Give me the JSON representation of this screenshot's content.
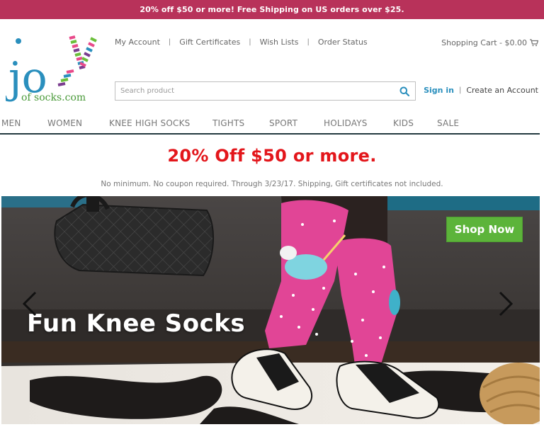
{
  "promo": {
    "text": "20% off $50 or more! Free Shipping on US orders over $25."
  },
  "logo": {
    "word": "joy",
    "subtitle": "of socks.com"
  },
  "top_links": [
    {
      "label": "My Account"
    },
    {
      "label": "Gift Certificates"
    },
    {
      "label": "Wish Lists"
    },
    {
      "label": "Order Status"
    }
  ],
  "cart": {
    "label": "Shopping Cart - $0.00"
  },
  "search": {
    "placeholder": "Search product"
  },
  "account": {
    "signin": "Sign in",
    "create": "Create an Account"
  },
  "nav": [
    {
      "label": "MEN"
    },
    {
      "label": "WOMEN"
    },
    {
      "label": "KNEE HIGH SOCKS"
    },
    {
      "label": "TIGHTS"
    },
    {
      "label": "SPORT"
    },
    {
      "label": "HOLIDAYS"
    },
    {
      "label": "KIDS"
    },
    {
      "label": "SALE"
    }
  ],
  "headline": "20% Off $50 or more.",
  "subline": "No minimum. No coupon required. Through 3/23/17. Shipping, Gift certificates not included.",
  "hero": {
    "title": "Fun Knee Socks",
    "cta": "Shop Now"
  },
  "colors": {
    "promo_bg": "#b8325a",
    "headline_red": "#e3161b",
    "cta_green": "#5cb43a",
    "signin_blue": "#2a8fbd"
  }
}
